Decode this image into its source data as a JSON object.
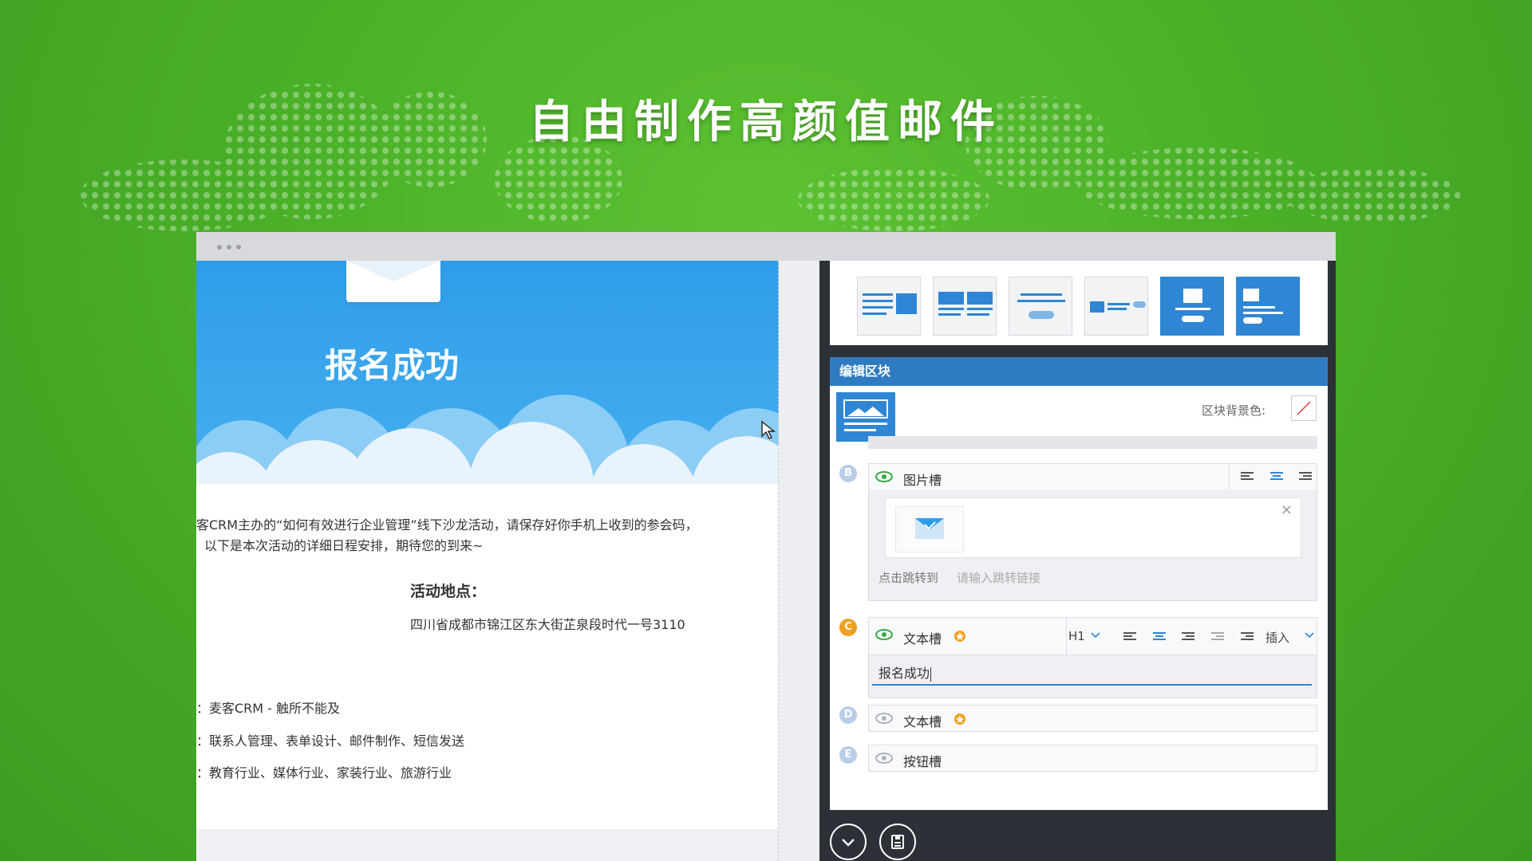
{
  "headline": "自由制作高颜值邮件",
  "email": {
    "hero_title": "报名成功",
    "intro_line1": "客CRM主办的“如何有效进行企业管理”线下沙龙活动，请保存好你手机上收到的参会码，",
    "intro_line2": "以下是本次活动的详细日程安排，期待您的到来~",
    "location_title": "活动地点：",
    "location_address": "四川省成都市锦江区东大街芷泉段时代一号3110",
    "detail_lines": [
      "：麦客CRM - 触所不能及",
      "：联系人管理、表单设计、邮件制作、短信发送",
      "：教育行业、媒体行业、家装行业、旅游行业"
    ]
  },
  "editor": {
    "panel_title": "编辑区块",
    "block_bg_label": "区块背景色:",
    "slots": [
      {
        "letter": "B",
        "label": "图片槽",
        "color": "#b9cde8"
      },
      {
        "letter": "C",
        "label": "文本槽",
        "color": "#f0a020"
      },
      {
        "letter": "D",
        "label": "文本槽",
        "color": "#b9cde8"
      },
      {
        "letter": "E",
        "label": "按钮槽",
        "color": "#b9cde8"
      }
    ],
    "image_slot": {
      "link_label": "点击跳转到",
      "link_placeholder": "请输入跳转链接",
      "close": "×"
    },
    "text_slot": {
      "heading_level": "H1",
      "insert_label": "插入",
      "value": "报名成功"
    }
  },
  "icons": {
    "eye": "eye-icon",
    "star": "star-badge-icon",
    "scroll_down": "chevron-down-icon",
    "save": "save-icon",
    "cursor": "mouse-cursor-icon"
  },
  "colors": {
    "background_green": "#4ab028",
    "hero_blue": "#2e9de8",
    "editor_header": "#2f7bc1",
    "selected_thumb": "#2e86d4"
  }
}
